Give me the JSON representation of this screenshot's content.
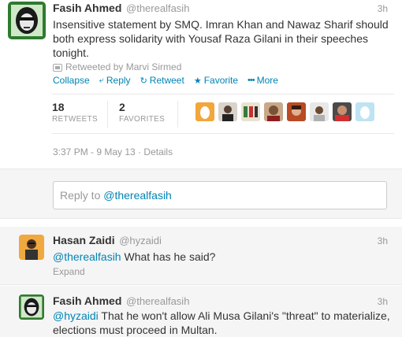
{
  "main_tweet": {
    "fullname": "Fasih Ahmed",
    "username": "@therealfasih",
    "time": "3h",
    "text_line1": "Insensitive statement by SMQ. Imran Khan and Nawaz Sharif should",
    "text_line2": "both express solidarity with Yousaf Raza Gilani in their speeches",
    "text_line3": "tonight.",
    "retweeted_by": "Retweeted by Marvi Sirmed",
    "actions": {
      "collapse": "Collapse",
      "reply": "Reply",
      "retweet": "Retweet",
      "favorite": "Favorite",
      "more": "More"
    },
    "stats": {
      "retweets_count": "18",
      "retweets_label": "RETWEETS",
      "favorites_count": "2",
      "favorites_label": "FAVORITES"
    },
    "timestamp": "3:37 PM - 9 May 13",
    "details": "Details"
  },
  "reply_box": {
    "prefix": "Reply to ",
    "mention": "@therealfasih"
  },
  "reply1": {
    "fullname": "Hasan Zaidi",
    "username": "@hyzaidi",
    "time": "3h",
    "mention": "@therealfasih",
    "text": " What has he said?",
    "expand": "Expand"
  },
  "reply2": {
    "fullname": "Fasih Ahmed",
    "username": "@therealfasih",
    "time": "3h",
    "mention": "@hyzaidi",
    "text_line1": " That he won't allow Ali Musa Gilani's \"threat\" to materialize,",
    "text_line2": "elections must proceed in Multan."
  },
  "colors": {
    "link": "#0084b4",
    "muted": "#999999",
    "text": "#333333",
    "stream_bg": "#f5f5f5"
  },
  "icons": [
    "retweet-icon",
    "reply-icon",
    "favorite-star-icon",
    "more-dots-icon",
    "default-egg-avatar"
  ]
}
